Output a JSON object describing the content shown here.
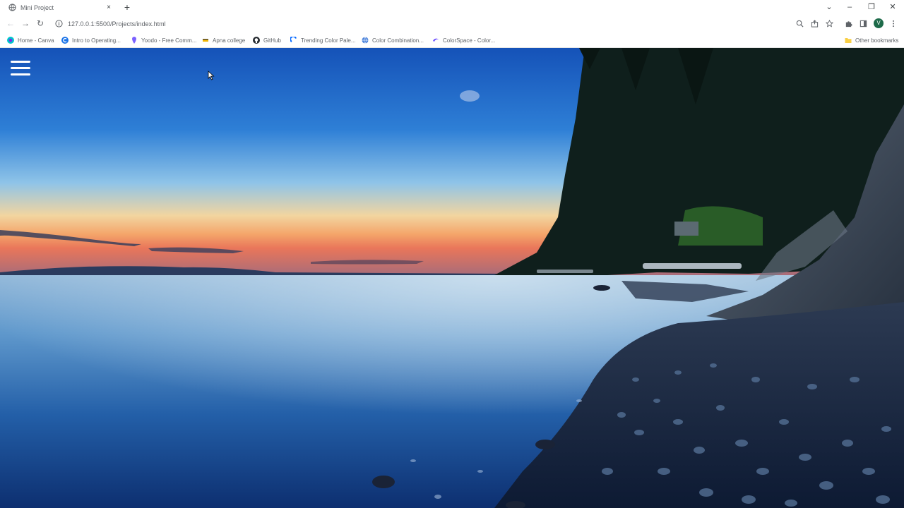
{
  "browser": {
    "tab": {
      "title": "Mini Project",
      "close_glyph": "×"
    },
    "new_tab_glyph": "+",
    "window_controls": {
      "dropdown": "⌄",
      "minimize": "–",
      "restore": "❐",
      "close": "✕"
    },
    "nav": {
      "back": "←",
      "forward": "→",
      "reload": "↻"
    },
    "url": "127.0.0.1:5500/Projects/index.html",
    "profile_initial": "V",
    "bookmarks": [
      {
        "label": "Home - Canva",
        "icon": "canva-icon",
        "color": "#00c4cc"
      },
      {
        "label": "Intro to Operating...",
        "icon": "c-icon",
        "color": "#1a73e8"
      },
      {
        "label": "Yoodo - Free Comm...",
        "icon": "pin-icon",
        "color": "#7b61ff"
      },
      {
        "label": "Apna college",
        "icon": "apna-icon",
        "color": "#f2b705"
      },
      {
        "label": "GitHub",
        "icon": "github-icon",
        "color": "#24292f"
      },
      {
        "label": "Trending Color Pale...",
        "icon": "coolors-icon",
        "color": "#0066ff"
      },
      {
        "label": "Color Combination...",
        "icon": "globe-icon",
        "color": "#3c78d8"
      },
      {
        "label": "ColorSpace - Color...",
        "icon": "colorspace-icon",
        "color": "#6a4cff"
      }
    ],
    "other_bookmarks": "Other bookmarks"
  },
  "page": {
    "menu_icon": "hamburger-icon",
    "background": "ocean-sunset-landscape"
  }
}
